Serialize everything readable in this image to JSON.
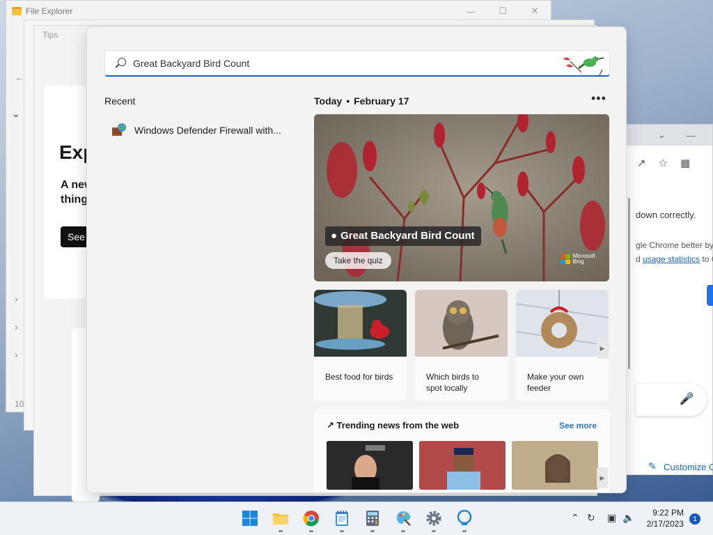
{
  "background_windows": {
    "file_explorer": {
      "title": "File Explorer",
      "status_count": "10"
    },
    "tips": {
      "title": "Tips",
      "heading": "Exp",
      "body_line1": "A new",
      "body_line2": "thing",
      "button": "See"
    },
    "chrome": {
      "message": "down correctly.",
      "line2": "gle Chrome better by",
      "line3_prefix": "d ",
      "line3_link": "usage statistics",
      "line3_suffix": " to G",
      "customize": "Customize C"
    }
  },
  "search": {
    "query": "Great Backyard Bird Count",
    "recent_label": "Recent",
    "recent_items": [
      {
        "label": "Windows Defender Firewall with..."
      }
    ],
    "today": {
      "label": "Today",
      "date": "February 17"
    },
    "more_label": "•••",
    "hero": {
      "tag": "Great Backyard Bird Count",
      "quiz_button": "Take the quiz",
      "brand_line1": "Microsoft",
      "brand_line2": "Bing"
    },
    "cards": [
      {
        "label": "Best food for birds"
      },
      {
        "label": "Which birds to spot locally"
      },
      {
        "label": "Make your own feeder"
      }
    ],
    "trending": {
      "title": "Trending news from the web",
      "see_more": "See more"
    }
  },
  "taskbar": {
    "apps": [
      "windows-start",
      "file-explorer",
      "chrome",
      "notepad",
      "calculator",
      "paint",
      "settings",
      "copilot"
    ],
    "clock": {
      "time": "9:22 PM",
      "date": "2/17/2023"
    },
    "notification_count": "1"
  },
  "colors": {
    "accent": "#1a63b8",
    "link": "#2a74c4",
    "notification": "#1359c2"
  }
}
